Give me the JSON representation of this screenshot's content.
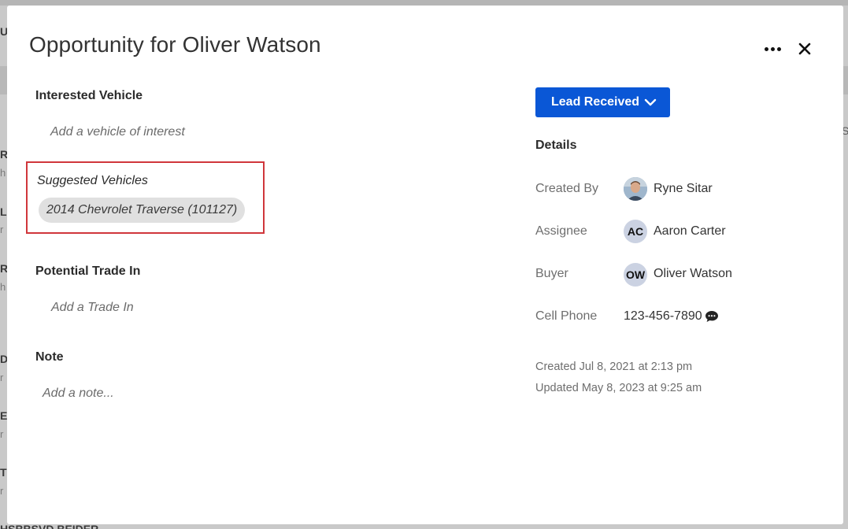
{
  "modal": {
    "title": "Opportunity for Oliver Watson"
  },
  "left": {
    "interested_vehicle": {
      "label": "Interested Vehicle",
      "placeholder": "Add a vehicle of interest"
    },
    "suggested_vehicles": {
      "label": "Suggested Vehicles",
      "items": [
        "2014 Chevrolet Traverse (101127)"
      ]
    },
    "trade_in": {
      "label": "Potential Trade In",
      "placeholder": "Add a Trade In"
    },
    "note": {
      "label": "Note",
      "placeholder": "Add a note..."
    }
  },
  "right": {
    "status_button": "Lead Received",
    "details_heading": "Details",
    "details": {
      "created_by": {
        "label": "Created By",
        "value": "Ryne Sitar"
      },
      "assignee": {
        "label": "Assignee",
        "initials": "AC",
        "value": "Aaron Carter"
      },
      "buyer": {
        "label": "Buyer",
        "initials": "OW",
        "value": "Oliver Watson"
      },
      "cell_phone": {
        "label": "Cell Phone",
        "value": "123-456-7890"
      }
    },
    "created": "Created Jul 8, 2021 at 2:13 pm",
    "updated": "Updated May 8, 2023 at 9:25 am"
  },
  "background": {
    "fragments": [
      "U",
      "R",
      "h",
      "L",
      "r",
      "R",
      "h",
      "D",
      "r",
      "E",
      "r",
      "T",
      "r"
    ],
    "right_fragment": "S",
    "bottom_text": "HSBBSVD BEIDER"
  },
  "colors": {
    "accent": "#0a57d6",
    "highlight_border": "#d0363b"
  }
}
